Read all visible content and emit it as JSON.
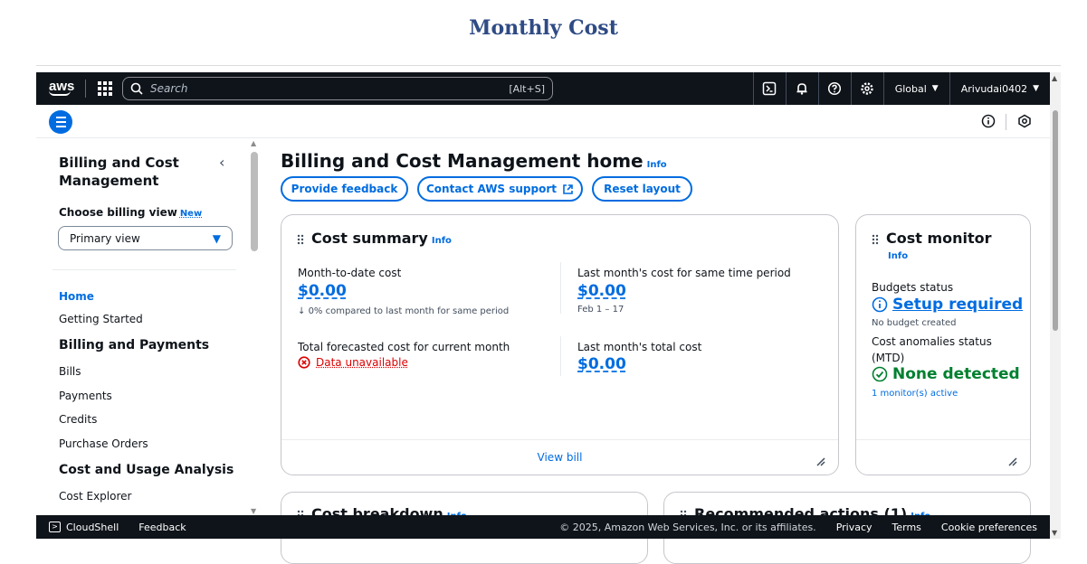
{
  "page_heading": "Monthly Cost",
  "topnav": {
    "logo": "aws",
    "search_placeholder": "Search",
    "search_shortcut": "[Alt+S]",
    "region": "Global",
    "account": "Arivudai0402"
  },
  "sidebar": {
    "title": "Billing and Cost Management",
    "billing_view_label": "Choose billing view",
    "billing_view_badge": "New",
    "billing_view_value": "Primary view",
    "items": {
      "home": "Home",
      "getting_started": "Getting Started",
      "section_billing": "Billing and Payments",
      "bills": "Bills",
      "payments": "Payments",
      "credits": "Credits",
      "purchase_orders": "Purchase Orders",
      "section_cost": "Cost and Usage Analysis",
      "cost_explorer": "Cost Explorer"
    }
  },
  "main": {
    "title": "Billing and Cost Management home",
    "info": "Info",
    "buttons": {
      "feedback": "Provide feedback",
      "support": "Contact AWS support",
      "reset": "Reset layout"
    }
  },
  "cost_summary": {
    "title": "Cost summary",
    "info": "Info",
    "mtd_label": "Month-to-date cost",
    "mtd_value": "$0.00",
    "mtd_compare": "0% compared to last month for same period",
    "last_same_label": "Last month's cost for same time period",
    "last_same_value": "$0.00",
    "last_same_range": "Feb 1 – 17",
    "forecast_label": "Total forecasted cost for current month",
    "forecast_value": "Data unavailable",
    "last_total_label": "Last month's total cost",
    "last_total_value": "$0.00",
    "footer_link": "View bill"
  },
  "cost_monitor": {
    "title": "Cost monitor",
    "info": "Info",
    "budgets_label": "Budgets status",
    "budgets_value": "Setup required",
    "budgets_sub": "No budget created",
    "anomalies_label_1": "Cost anomalies status",
    "anomalies_label_2": "(MTD)",
    "anomalies_value": "None detected",
    "monitors_active": "1 monitor(s) active"
  },
  "lower_cards": {
    "breakdown_title": "Cost breakdown",
    "breakdown_info": "Info",
    "recommended_title": "Recommended actions (1)",
    "recommended_info": "Info"
  },
  "footer": {
    "cloudshell": "CloudShell",
    "feedback": "Feedback",
    "copyright": "© 2025, Amazon Web Services, Inc. or its affiliates.",
    "privacy": "Privacy",
    "terms": "Terms",
    "cookies": "Cookie preferences"
  },
  "colors": {
    "accent": "#006ce0",
    "success": "#00802f",
    "error": "#db0000",
    "nav_bg": "#0f141a",
    "heading": "#2f4b85"
  },
  "icons": [
    "search-icon",
    "apps-grid-icon",
    "cloudshell-icon",
    "bell-icon",
    "help-icon",
    "gear-icon",
    "menu-icon",
    "info-circle-icon",
    "notifications-hex-icon",
    "external-link-icon",
    "drag-handle-icon",
    "arrow-down-icon",
    "error-icon",
    "check-circle-icon",
    "resize-icon"
  ]
}
